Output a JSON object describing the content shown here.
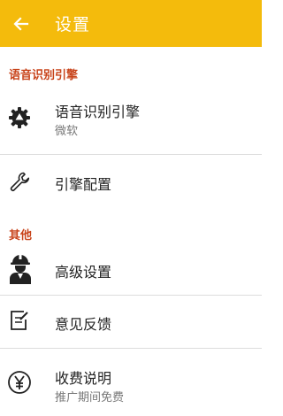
{
  "appbar": {
    "title": "设置",
    "bg_color": "#F4BB0C"
  },
  "sections": [
    {
      "header": "语音识别引擎"
    },
    {
      "header": "其他"
    }
  ],
  "items": {
    "engine": {
      "title": "语音识别引擎",
      "subtitle": "微软",
      "icon": "gear-icon"
    },
    "config": {
      "title": "引擎配置",
      "icon": "wrench-icon"
    },
    "advanced": {
      "title": "高级设置",
      "icon": "worker-icon"
    },
    "feedback": {
      "title": "意见反馈",
      "icon": "edit-note-icon"
    },
    "fees": {
      "title": "收费说明",
      "subtitle": "推广期间免费",
      "icon": "yen-icon"
    }
  },
  "accent_color": "#C8431A"
}
